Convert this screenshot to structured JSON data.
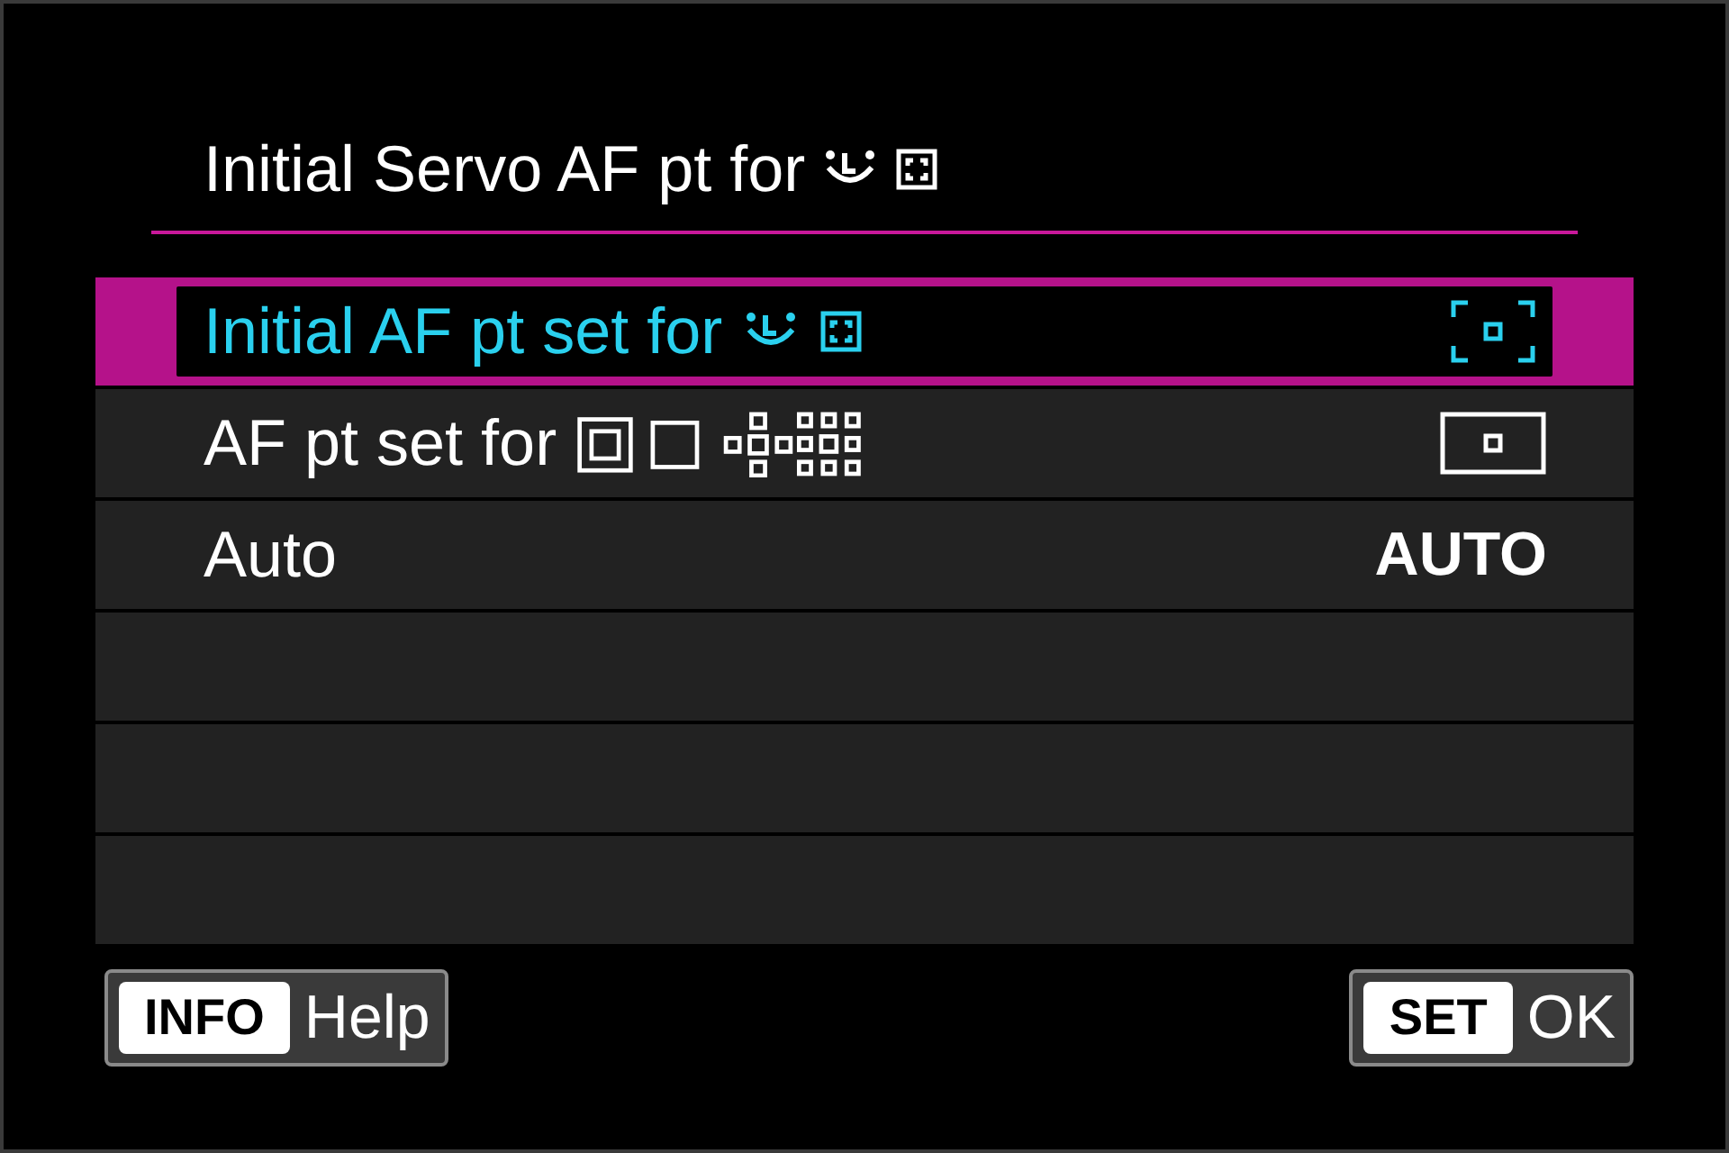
{
  "title": "Initial Servo AF pt for",
  "options": [
    {
      "kind": "face-tracking",
      "label": "Initial AF pt set for",
      "selected": true
    },
    {
      "kind": "af-area",
      "label": "AF pt set for",
      "selected": false
    },
    {
      "kind": "auto",
      "label": "Auto",
      "value": "AUTO",
      "selected": false
    },
    {
      "kind": "empty"
    },
    {
      "kind": "empty"
    },
    {
      "kind": "empty"
    }
  ],
  "footer_buttons": [
    {
      "key": "INFO",
      "label": "Help"
    },
    {
      "key": "SET",
      "label": "OK"
    }
  ]
}
